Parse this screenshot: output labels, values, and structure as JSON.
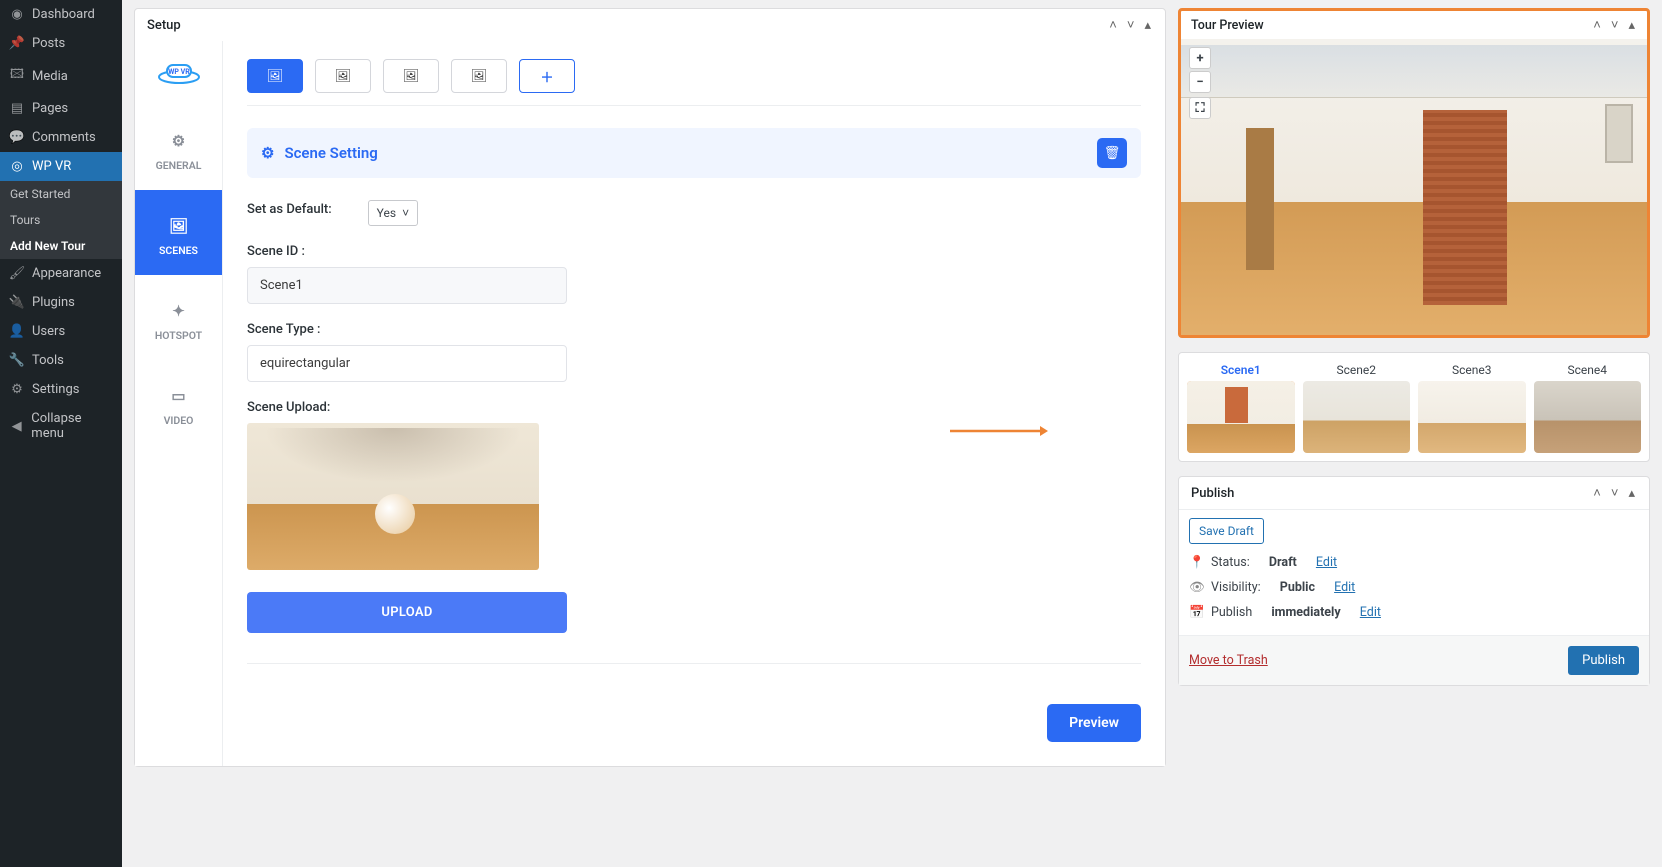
{
  "wp_menu": {
    "dashboard": "Dashboard",
    "posts": "Posts",
    "media": "Media",
    "pages": "Pages",
    "comments": "Comments",
    "wpvr": "WP VR",
    "appearance": "Appearance",
    "plugins": "Plugins",
    "users": "Users",
    "tools": "Tools",
    "settings": "Settings",
    "collapse": "Collapse menu"
  },
  "wpvr_sub": {
    "get_started": "Get Started",
    "tours": "Tours",
    "add_new": "Add New Tour"
  },
  "setup": {
    "title": "Setup",
    "vtabs": {
      "general": "GENERAL",
      "scenes": "SCENES",
      "hotspot": "HOTSPOT",
      "video": "VIDEO"
    },
    "scene_setting": "Scene Setting",
    "default_label": "Set as Default:",
    "default_value": "Yes",
    "scene_id_label": "Scene ID :",
    "scene_id_value": "Scene1",
    "scene_type_label": "Scene Type :",
    "scene_type_value": "equirectangular",
    "scene_upload_label": "Scene Upload:",
    "upload_btn": "UPLOAD",
    "preview_btn": "Preview"
  },
  "tour_preview": {
    "title": "Tour Preview",
    "scenes": [
      "Scene1",
      "Scene2",
      "Scene3",
      "Scene4"
    ]
  },
  "publish": {
    "title": "Publish",
    "save_draft": "Save Draft",
    "status_label": "Status:",
    "status_value": "Draft",
    "visibility_label": "Visibility:",
    "visibility_value": "Public",
    "schedule_label": "Publish",
    "schedule_value": "immediately",
    "edit": "Edit",
    "move_trash": "Move to Trash",
    "publish_btn": "Publish"
  }
}
